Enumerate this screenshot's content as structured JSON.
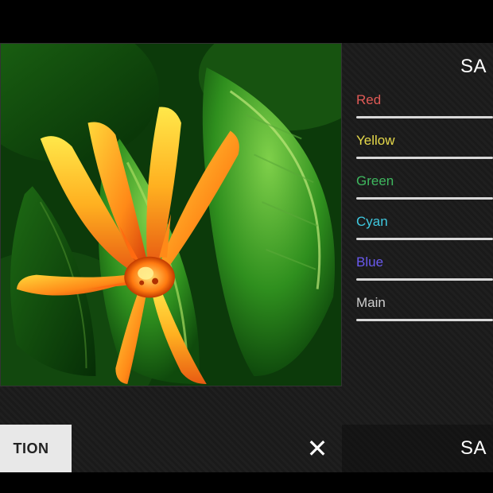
{
  "header": {
    "title_fragment": "SA"
  },
  "footer": {
    "label_fragment": "SA"
  },
  "bottom_tab": {
    "label_fragment": "TION"
  },
  "sliders": [
    {
      "label": "Red",
      "color": "#e05a56"
    },
    {
      "label": "Yellow",
      "color": "#e6d94a"
    },
    {
      "label": "Green",
      "color": "#3fb85f"
    },
    {
      "label": "Cyan",
      "color": "#3fc9e0"
    },
    {
      "label": "Blue",
      "color": "#6a5af0"
    },
    {
      "label": "Main",
      "color": "#d0d0d0"
    }
  ]
}
